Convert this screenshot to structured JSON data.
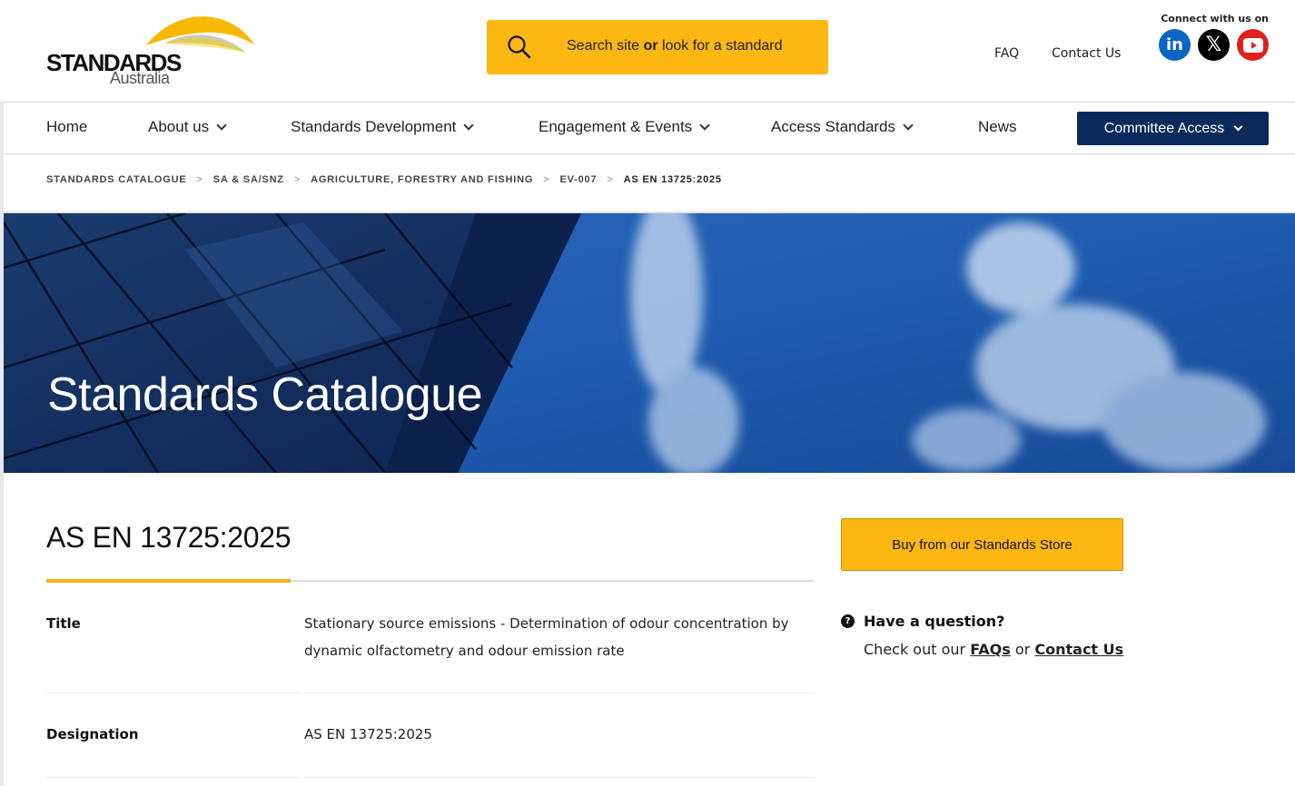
{
  "header": {
    "logo_word": "STANDARDS",
    "logo_sub": "Australia",
    "search_prefix": "Search site",
    "search_or": "or",
    "search_suffix": "look for a standard",
    "faq_link": "FAQ",
    "contact_link": "Contact Us",
    "connect_label": "Connect with us on",
    "social": {
      "linkedin": "in",
      "x": "𝕏"
    }
  },
  "nav": {
    "home": "Home",
    "about": "About us",
    "development": "Standards Development",
    "engagement": "Engagement & Events",
    "access": "Access Standards",
    "news": "News",
    "committee": "Committee Access"
  },
  "breadcrumb": {
    "items": [
      "STANDARDS CATALOGUE",
      "SA & SA/SNZ",
      "AGRICULTURE, FORESTRY AND FISHING",
      "EV-007"
    ],
    "current": "AS EN 13725:2025",
    "separator": ">"
  },
  "hero": {
    "title": "Standards Catalogue"
  },
  "standard": {
    "heading": "AS EN 13725:2025",
    "rows": [
      {
        "label": "Title",
        "value": "Stationary source emissions - Determination of odour concentration by dynamic olfactometry and odour emission rate"
      },
      {
        "label": "Designation",
        "value": "AS EN 13725:2025"
      }
    ]
  },
  "sidebar": {
    "buy_button": "Buy from our Standards Store",
    "question_icon": "?",
    "question_title": "Have a question?",
    "question_text_prefix": "Check out our",
    "question_or": "or",
    "faqs_link": "FAQs",
    "contact_link": "Contact Us"
  },
  "colors": {
    "accent_yellow": "#fdb713",
    "navy": "#0a2a5c",
    "linkedin": "#0a66c2",
    "youtube": "#e01f1f"
  }
}
